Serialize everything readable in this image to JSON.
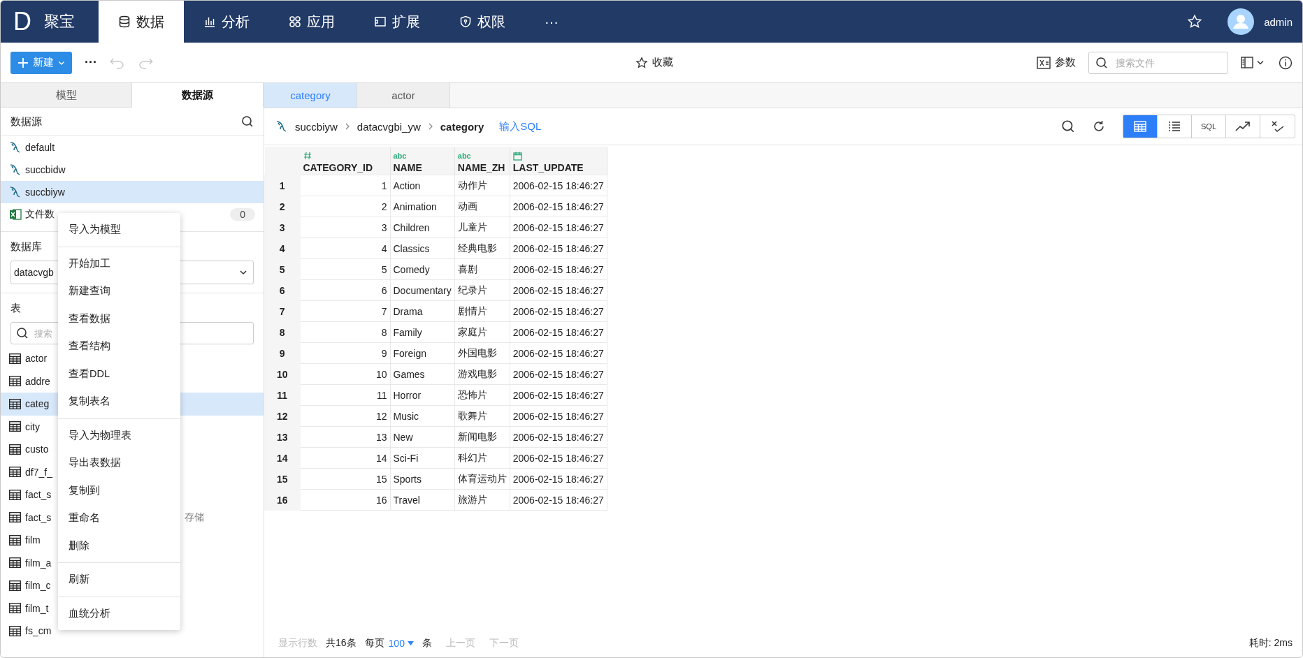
{
  "nav": {
    "logo": "D",
    "brand": "聚宝",
    "items": [
      {
        "kind": "database",
        "label": "数据",
        "selected": true
      },
      {
        "kind": "chart",
        "label": "分析",
        "selected": false
      },
      {
        "kind": "apps",
        "label": "应用",
        "selected": false
      },
      {
        "kind": "plugin",
        "label": "扩展",
        "selected": false
      },
      {
        "kind": "shield",
        "label": "权限",
        "selected": false
      },
      {
        "kind": "more",
        "label": "···",
        "selected": false
      }
    ],
    "user": "admin"
  },
  "toolbar": {
    "new_button": "新建",
    "more": "···",
    "history": [
      {
        "kind": "undo",
        "disabled": true
      },
      {
        "kind": "redo",
        "disabled": true
      }
    ],
    "favorite": "收藏",
    "params": "参数",
    "search": {
      "placeholder": "搜索文件"
    }
  },
  "left": {
    "tabs": [
      {
        "label": "模型",
        "selected": false
      },
      {
        "label": "数据源",
        "selected": true
      }
    ],
    "sources_title": "数据源",
    "sources": [
      {
        "kind": "mysql",
        "label": "default",
        "selected": false
      },
      {
        "kind": "mysql",
        "label": "succbidw",
        "selected": false
      },
      {
        "kind": "mysql",
        "label": "succbiyw",
        "selected": true
      },
      {
        "kind": "excel",
        "label": "文件数",
        "selected": false,
        "count": "0"
      }
    ],
    "database_label": "数据库",
    "database_value": "datacvgb",
    "tables_label": "表",
    "table_search": {
      "placeholder": "搜索"
    },
    "tables": [
      {
        "label": "actor",
        "selected": false
      },
      {
        "label": "addre",
        "selected": false
      },
      {
        "label": "categ",
        "selected": true
      },
      {
        "label": "city",
        "selected": false
      },
      {
        "label": "custo",
        "selected": false
      },
      {
        "label": "df7_f_",
        "selected": false
      },
      {
        "label": "fact_s",
        "selected": false
      },
      {
        "label": "fact_s",
        "selected": false,
        "note": "存储"
      },
      {
        "label": "film",
        "selected": false
      },
      {
        "label": "film_a",
        "selected": false
      },
      {
        "label": "film_c",
        "selected": false
      },
      {
        "label": "film_t",
        "selected": false
      },
      {
        "label": "fs_cm",
        "selected": false
      }
    ]
  },
  "context_menu": [
    [
      "导入为模型"
    ],
    [
      "开始加工",
      "新建查询",
      "查看数据",
      "查看结构",
      "查看DDL",
      "复制表名"
    ],
    [
      "导入为物理表",
      "导出表数据",
      "复制到",
      "重命名",
      "删除"
    ],
    [
      "刷新"
    ],
    [
      "血统分析"
    ]
  ],
  "editor": {
    "tabs": [
      {
        "label": "category",
        "selected": true
      },
      {
        "label": "actor",
        "selected": false
      }
    ],
    "breadcrumb": [
      "succbiyw",
      "datacvgbi_yw",
      "category"
    ],
    "sql_link": "输入SQL",
    "views": [
      {
        "kind": "grid",
        "selected": true
      },
      {
        "kind": "list",
        "selected": false
      },
      {
        "kind": "sql",
        "label": "SQL",
        "selected": false
      },
      {
        "kind": "trend",
        "selected": false
      },
      {
        "kind": "compare",
        "selected": false
      }
    ],
    "columns": [
      {
        "name": "CATEGORY_ID",
        "kind": "number"
      },
      {
        "name": "NAME",
        "kind": "text",
        "type_label": "abc"
      },
      {
        "name": "NAME_ZH",
        "kind": "text",
        "type_label": "abc"
      },
      {
        "name": "LAST_UPDATE",
        "kind": "date"
      }
    ],
    "rows": [
      {
        "n": "1",
        "cells": [
          "1",
          "Action",
          "动作片",
          "2006-02-15 18:46:27"
        ]
      },
      {
        "n": "2",
        "cells": [
          "2",
          "Animation",
          "动画",
          "2006-02-15 18:46:27"
        ]
      },
      {
        "n": "3",
        "cells": [
          "3",
          "Children",
          "儿童片",
          "2006-02-15 18:46:27"
        ]
      },
      {
        "n": "4",
        "cells": [
          "4",
          "Classics",
          "经典电影",
          "2006-02-15 18:46:27"
        ]
      },
      {
        "n": "5",
        "cells": [
          "5",
          "Comedy",
          "喜剧",
          "2006-02-15 18:46:27"
        ]
      },
      {
        "n": "6",
        "cells": [
          "6",
          "Documentary",
          "纪录片",
          "2006-02-15 18:46:27"
        ]
      },
      {
        "n": "7",
        "cells": [
          "7",
          "Drama",
          "剧情片",
          "2006-02-15 18:46:27"
        ]
      },
      {
        "n": "8",
        "cells": [
          "8",
          "Family",
          "家庭片",
          "2006-02-15 18:46:27"
        ]
      },
      {
        "n": "9",
        "cells": [
          "9",
          "Foreign",
          "外国电影",
          "2006-02-15 18:46:27"
        ]
      },
      {
        "n": "10",
        "cells": [
          "10",
          "Games",
          "游戏电影",
          "2006-02-15 18:46:27"
        ]
      },
      {
        "n": "11",
        "cells": [
          "11",
          "Horror",
          "恐怖片",
          "2006-02-15 18:46:27"
        ]
      },
      {
        "n": "12",
        "cells": [
          "12",
          "Music",
          "歌舞片",
          "2006-02-15 18:46:27"
        ]
      },
      {
        "n": "13",
        "cells": [
          "13",
          "New",
          "新闻电影",
          "2006-02-15 18:46:27"
        ]
      },
      {
        "n": "14",
        "cells": [
          "14",
          "Sci-Fi",
          "科幻片",
          "2006-02-15 18:46:27"
        ]
      },
      {
        "n": "15",
        "cells": [
          "15",
          "Sports",
          "体育运动片",
          "2006-02-15 18:46:27"
        ]
      },
      {
        "n": "16",
        "cells": [
          "16",
          "Travel",
          "旅游片",
          "2006-02-15 18:46:27"
        ]
      }
    ],
    "footer": {
      "rows_label": {
        "label": "显示行数",
        "disabled": true
      },
      "total": "共16条",
      "per_page": "每页",
      "page_size": "100",
      "unit": "条",
      "pager": [
        {
          "label": "上一页",
          "disabled": true
        },
        {
          "label": "下一页",
          "disabled": true
        }
      ],
      "elapsed": "耗时: 2ms"
    }
  }
}
